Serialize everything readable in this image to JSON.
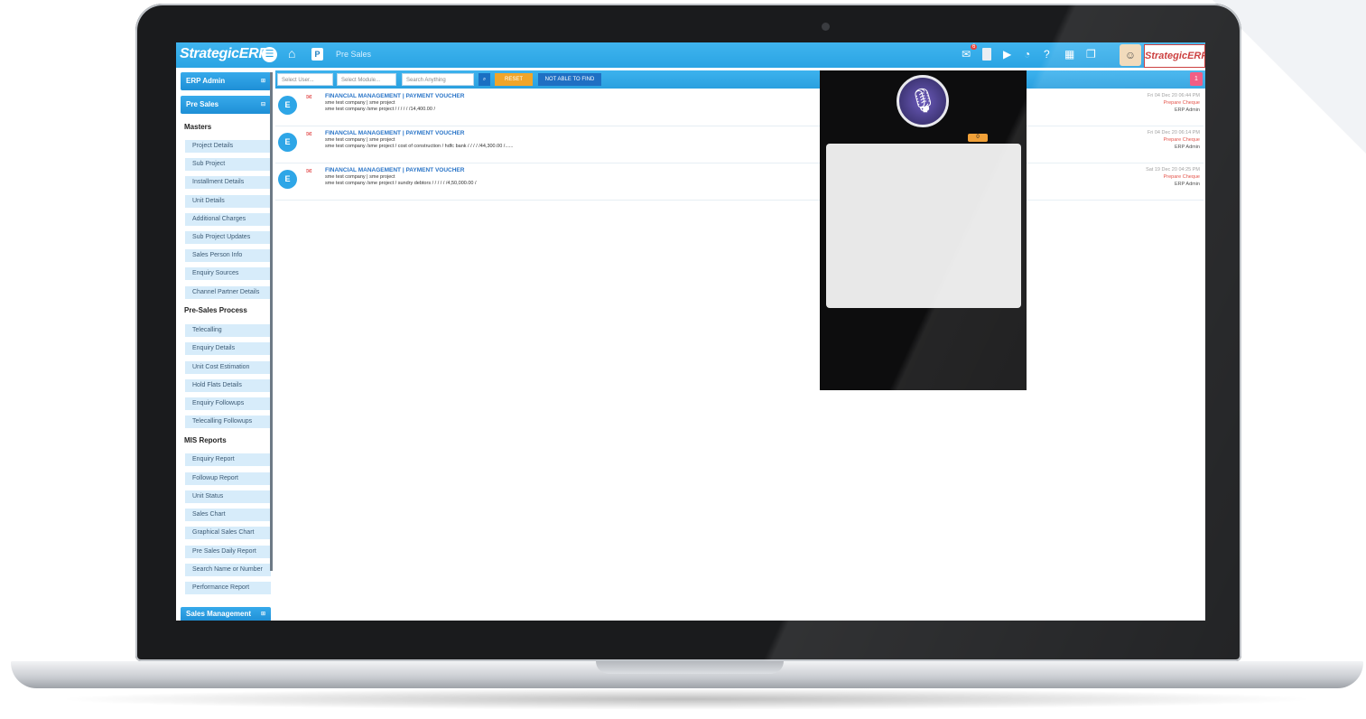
{
  "app": {
    "logo": "StrategicERP",
    "breadcrumb": "Pre Sales",
    "mail_badge": "6",
    "brand_badge": "StrategicERP"
  },
  "icons": {
    "menu": "menu-icon",
    "home": "home-icon",
    "mail": "mail-icon",
    "bookmark": "bookmark-icon",
    "video": "youtube-icon",
    "chart": "pie-chart-icon",
    "help": "help-icon",
    "calculator": "calculator-icon",
    "window": "window-icon",
    "user": "user-avatar-icon",
    "mic": "microphone-icon"
  },
  "colors": {
    "accent": "#2aa4e3",
    "sidebar_item_bg": "#d7ecfa",
    "reset_btn": "#f0a52a",
    "notable_btn": "#1f6fc3",
    "status_red": "#e2453b"
  },
  "sidebar": {
    "erp_admin": "ERP Admin",
    "pre_sales": "Pre Sales",
    "masters_title": "Masters",
    "masters": [
      "Project Details",
      "Sub Project",
      "Installment Details",
      "Unit Details",
      "Additional Charges",
      "Sub Project Updates",
      "Sales Person Info",
      "Enquiry Sources",
      "Channel Partner Details"
    ],
    "process_title": "Pre-Sales Process",
    "process": [
      "Telecalling",
      "Enquiry Details",
      "Unit Cost Estimation",
      "Hold Flats Details",
      "Enquiry Followups",
      "Telecalling Followups"
    ],
    "mis_title": "MIS Reports",
    "mis": [
      "Enquiry Report",
      "Followup Report",
      "Unit Status",
      "Sales Chart",
      "Graphical Sales Chart",
      "Pre Sales Daily Report",
      "Search Name or Number",
      "Performance Report"
    ],
    "sales_management": "Sales Management"
  },
  "filters": {
    "select_user": "Select User...",
    "select_module": "Select Module...",
    "search": "Search Anything",
    "search_btn": "⌕",
    "reset": "RESET",
    "not_able": "NOT ABLE TO FIND",
    "pink_btn": "1"
  },
  "notifications": [
    {
      "avatar": "E",
      "title": "FINANCIAL MANAGEMENT | PAYMENT VOUCHER",
      "line1": "sme test company | sme project",
      "line2": "sme test company /sme project / / / / / /14,400.00 /",
      "date": "Fri 04 Dec 20 06:44 PM",
      "status": "Prepare Cheque",
      "user": "ERP Admin"
    },
    {
      "avatar": "E",
      "title": "FINANCIAL MANAGEMENT | PAYMENT VOUCHER",
      "line1": "sme test company | sme project",
      "line2": "sme test company /sme project / cost of construction / hdfc bank / / / / /44,300.00 /......",
      "date": "Fri 04 Dec 20 06:14 PM",
      "status": "Prepare Cheque",
      "user": "ERP Admin"
    },
    {
      "avatar": "E",
      "title": "FINANCIAL MANAGEMENT | PAYMENT VOUCHER",
      "line1": "sme test company | sme project",
      "line2": "sme test company /sme project / sundry debtors / / / / / /4,50,000.00 /",
      "date": "Sat 19 Dec 20 04:25 PM",
      "status": "Prepare Cheque",
      "user": "ERP Admin"
    }
  ],
  "voice_panel": {
    "chip": "0"
  }
}
